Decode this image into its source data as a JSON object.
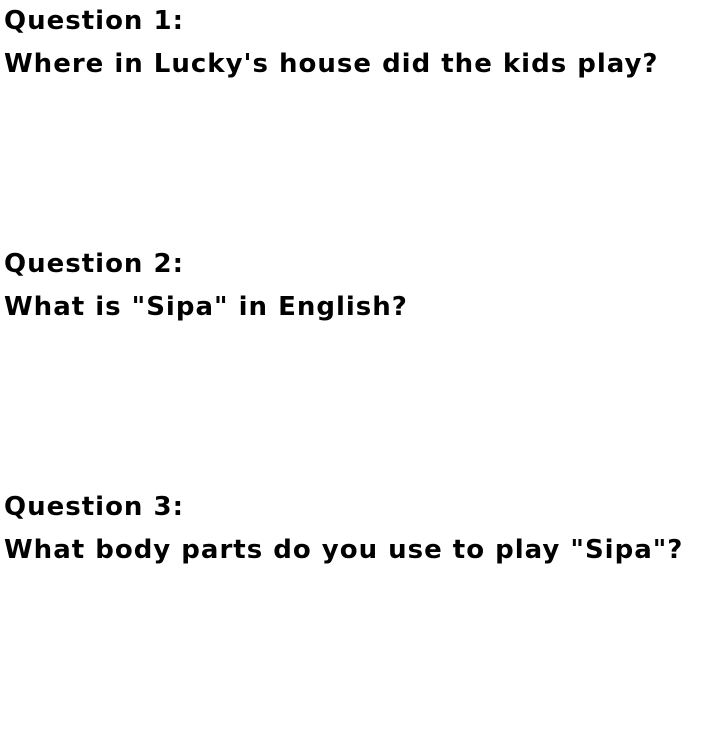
{
  "questions": [
    {
      "label": "Question 1:",
      "text": "Where in Lucky's house did the kids play?"
    },
    {
      "label": "Question 2:",
      "text": "What is \"Sipa\" in English?"
    },
    {
      "label": "Question 3:",
      "text": "What body parts do you use to play \"Sipa\"?"
    }
  ]
}
